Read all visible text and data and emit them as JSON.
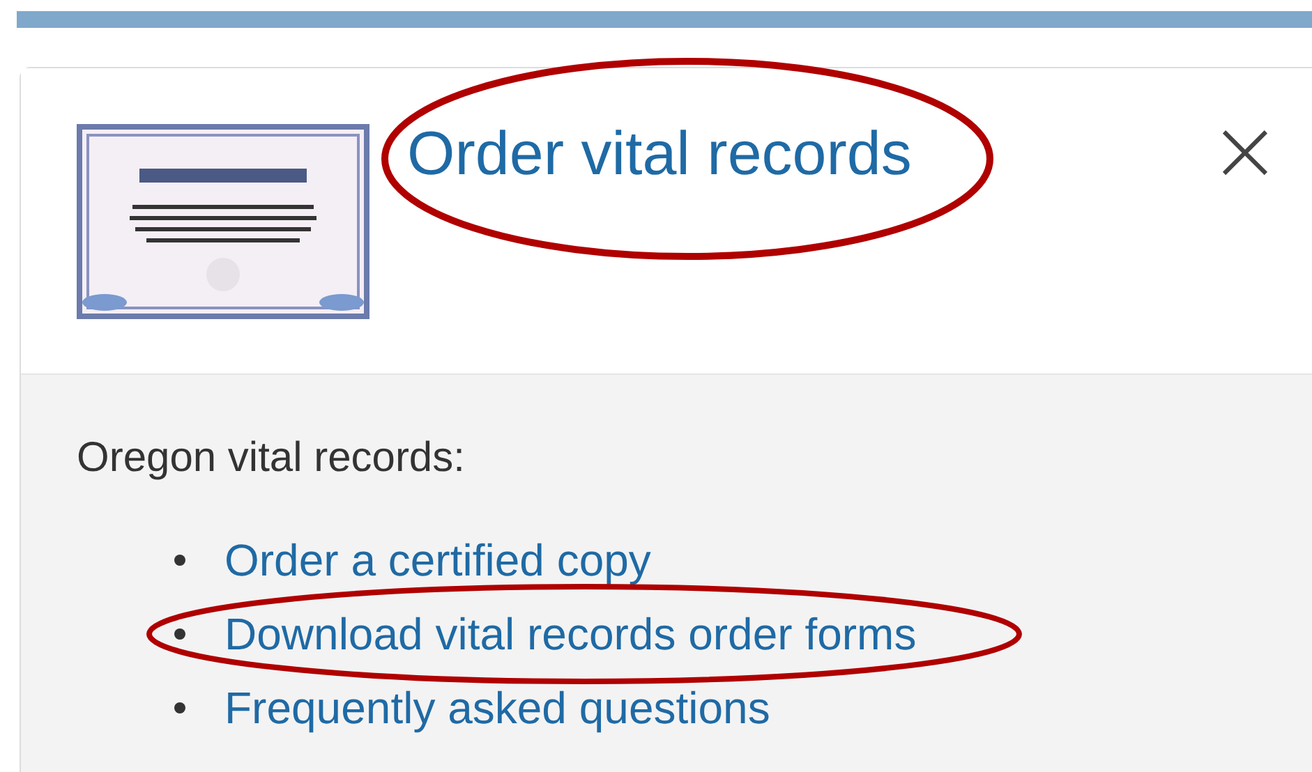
{
  "dialog": {
    "title": "Order vital records",
    "close": "×"
  },
  "body": {
    "intro": "Oregon vital records:",
    "links": [
      {
        "label": "Order a certified copy",
        "circled": false
      },
      {
        "label": "Download vital records order forms",
        "circled": true
      },
      {
        "label": "Frequently asked questions",
        "circled": false
      }
    ]
  }
}
